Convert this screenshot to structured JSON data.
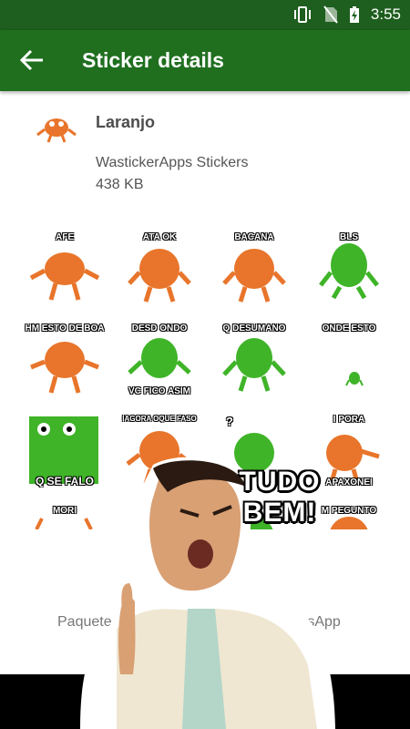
{
  "status_bar": {
    "time": "3:55",
    "icons": [
      "vibrate-icon",
      "no-sim-icon",
      "battery-charging-icon"
    ]
  },
  "app_bar": {
    "title": "Sticker details",
    "back_icon": "arrow-left-icon"
  },
  "pack": {
    "name": "Laranjo",
    "publisher": "WastickerApps Stickers",
    "size": "438 KB"
  },
  "stickers": [
    {
      "caption_top": "AFE",
      "caption_bottom": "",
      "color": "#e8752b"
    },
    {
      "caption_top": "ATA OK",
      "caption_bottom": "",
      "color": "#e8752b"
    },
    {
      "caption_top": "BACANA",
      "caption_bottom": "",
      "color": "#e8752b"
    },
    {
      "caption_top": "BLS",
      "caption_bottom": "",
      "color": "#3fb428"
    },
    {
      "caption_top": "HM ESTO DE BOA",
      "caption_bottom": "",
      "color": "#e8752b"
    },
    {
      "caption_top": "DESD ONDO",
      "caption_bottom": "VC FICO ASIM",
      "color": "#3fb428"
    },
    {
      "caption_top": "Q DESUMANO",
      "caption_bottom": "",
      "color": "#3fb428"
    },
    {
      "caption_top": "ONDE ESTO",
      "caption_bottom": "",
      "color": "#3fb428"
    },
    {
      "caption_top": "",
      "caption_bottom": "Q SE FALO",
      "color": "#3fb428"
    },
    {
      "caption_top": "IAGORA OQUE FASO",
      "caption_bottom": "",
      "color": "#e8752b"
    },
    {
      "caption_top": "?",
      "caption_bottom": "",
      "color": "#3fb428"
    },
    {
      "caption_top": "I PORA",
      "caption_bottom": "APAXONEI",
      "color": "#e8752b"
    },
    {
      "caption_top": "MORI",
      "caption_bottom": "",
      "color": "#e8752b"
    },
    {
      "caption_top": "",
      "caption_bottom": "",
      "color": "#e8752b"
    },
    {
      "caption_top": "",
      "caption_bottom": "",
      "color": "#3fb428"
    },
    {
      "caption_top": "M PEGUNTO",
      "caption_bottom": "",
      "color": "#e8752b"
    }
  ],
  "footer": {
    "text_left": "Paquete",
    "text_right": "WhatsApp"
  },
  "overlay": {
    "caption": "TUDO BEM!"
  }
}
